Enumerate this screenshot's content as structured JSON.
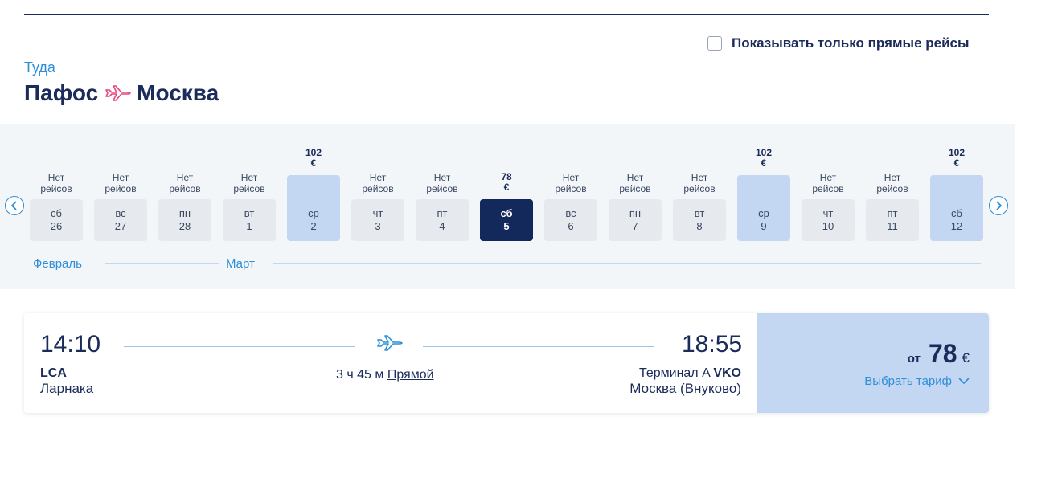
{
  "filter": {
    "direct_only_label": "Показывать только прямые рейсы",
    "checked": false
  },
  "leg": {
    "direction": "Туда",
    "from": "Пафос",
    "to": "Москва"
  },
  "calendar": {
    "months": [
      {
        "name": "Февраль"
      },
      {
        "name": "Март"
      }
    ],
    "days": [
      {
        "weekday": "сб",
        "date": "26",
        "no_flights": "Нет\nрейсов",
        "price": "",
        "currency": "",
        "state": "none"
      },
      {
        "weekday": "вс",
        "date": "27",
        "no_flights": "Нет\nрейсов",
        "price": "",
        "currency": "",
        "state": "none"
      },
      {
        "weekday": "пн",
        "date": "28",
        "no_flights": "Нет\nрейсов",
        "price": "",
        "currency": "",
        "state": "none"
      },
      {
        "weekday": "вт",
        "date": "1",
        "no_flights": "Нет\nрейсов",
        "price": "",
        "currency": "",
        "state": "none"
      },
      {
        "weekday": "ср",
        "date": "2",
        "no_flights": "",
        "price": "102",
        "currency": "€",
        "state": "available"
      },
      {
        "weekday": "чт",
        "date": "3",
        "no_flights": "Нет\nрейсов",
        "price": "",
        "currency": "",
        "state": "none"
      },
      {
        "weekday": "пт",
        "date": "4",
        "no_flights": "Нет\nрейсов",
        "price": "",
        "currency": "",
        "state": "none"
      },
      {
        "weekday": "сб",
        "date": "5",
        "no_flights": "",
        "price": "78",
        "currency": "€",
        "state": "selected"
      },
      {
        "weekday": "вс",
        "date": "6",
        "no_flights": "Нет\nрейсов",
        "price": "",
        "currency": "",
        "state": "none"
      },
      {
        "weekday": "пн",
        "date": "7",
        "no_flights": "Нет\nрейсов",
        "price": "",
        "currency": "",
        "state": "none"
      },
      {
        "weekday": "вт",
        "date": "8",
        "no_flights": "Нет\nрейсов",
        "price": "",
        "currency": "",
        "state": "none"
      },
      {
        "weekday": "ср",
        "date": "9",
        "no_flights": "",
        "price": "102",
        "currency": "€",
        "state": "available"
      },
      {
        "weekday": "чт",
        "date": "10",
        "no_flights": "Нет\nрейсов",
        "price": "",
        "currency": "",
        "state": "none"
      },
      {
        "weekday": "пт",
        "date": "11",
        "no_flights": "Нет\nрейсов",
        "price": "",
        "currency": "",
        "state": "none"
      },
      {
        "weekday": "сб",
        "date": "12",
        "no_flights": "",
        "price": "102",
        "currency": "€",
        "state": "available"
      }
    ]
  },
  "flight": {
    "departure_time": "14:10",
    "departure_code": "LCA",
    "departure_city": "Ларнака",
    "duration": "3 ч 45 м",
    "direct_label": "Прямой",
    "arrival_time": "18:55",
    "arrival_terminal": "Терминал A",
    "arrival_code": "VKO",
    "arrival_city": "Москва (Внуково)",
    "price_from": "от",
    "price": "78",
    "currency": "€",
    "select_tariff": "Выбрать тариф"
  },
  "colors": {
    "navy": "#1b2b5a",
    "accent_blue": "#2e8fd8",
    "plane_pink": "#e8457c",
    "calendar_bg": "#f3f6f9",
    "available_day": "#c3d6f2",
    "selected_day": "#13285b"
  },
  "icons": {
    "route": "airplane-icon",
    "nav_prev": "chevron-left-icon",
    "nav_next": "chevron-right-icon",
    "flight": "airplane-icon",
    "tariff": "chevron-down-icon"
  }
}
